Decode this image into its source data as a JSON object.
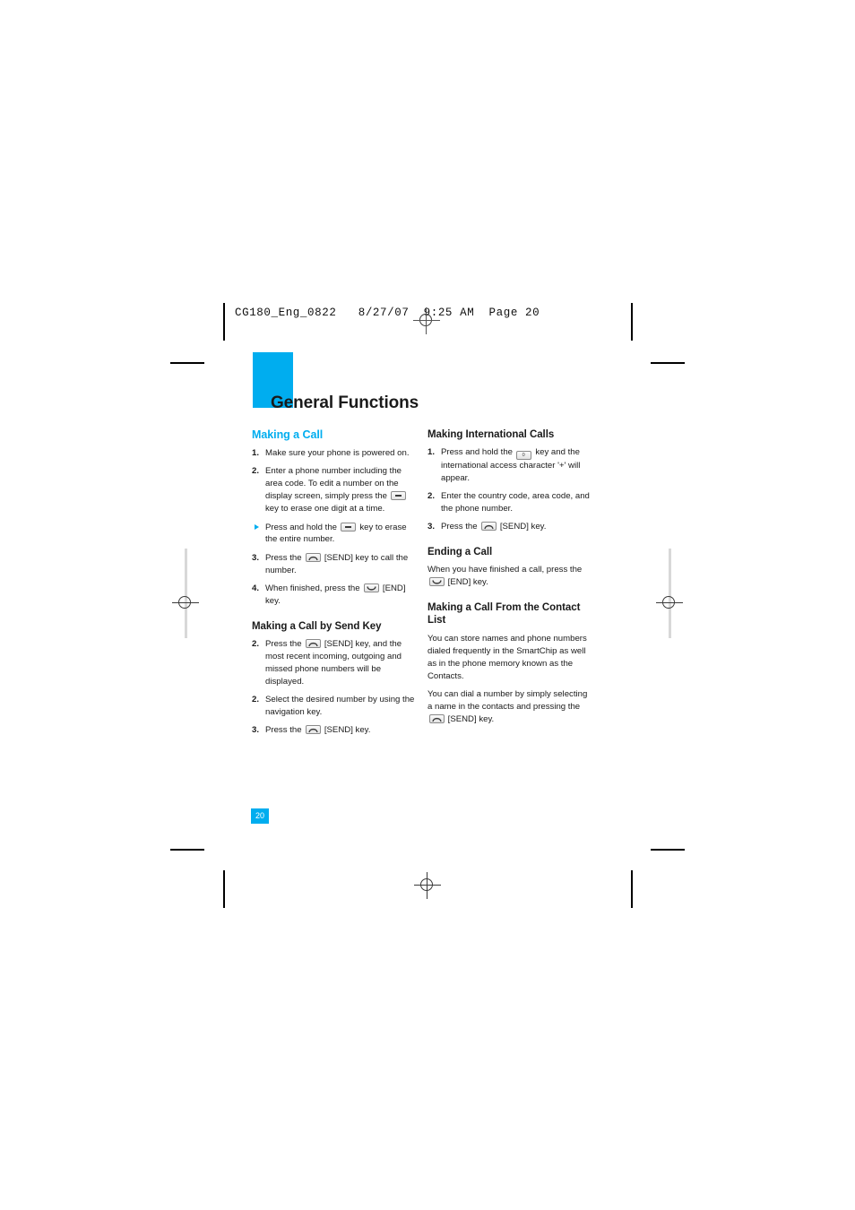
{
  "prepress": {
    "file_stamp": "CG180_Eng_0822   8/27/07  9:25 AM  Page 20"
  },
  "chapter": {
    "title": "General Functions"
  },
  "left_column": {
    "heading_making_a_call": "Making a Call",
    "steps_making_a_call": [
      {
        "num": "1.",
        "parts": [
          {
            "type": "text",
            "value": "Make sure your phone is powered on."
          }
        ]
      },
      {
        "num": "2.",
        "parts": [
          {
            "type": "text",
            "value": "Enter a phone number including the area code. To edit a number on the display screen, simply press the "
          },
          {
            "type": "key",
            "icon": "clear-key-icon"
          },
          {
            "type": "text",
            "value": " key to erase one digit at a time."
          }
        ]
      }
    ],
    "sub_bullet": {
      "parts": [
        {
          "type": "text",
          "value": "Press and hold the "
        },
        {
          "type": "key",
          "icon": "clear-key-icon"
        },
        {
          "type": "text",
          "value": " key to erase the entire number."
        }
      ]
    },
    "steps_making_a_call_cont": [
      {
        "num": "3.",
        "parts": [
          {
            "type": "text",
            "value": "Press the "
          },
          {
            "type": "key",
            "icon": "send-key-icon"
          },
          {
            "type": "text",
            "value": " [SEND] key to call the number."
          }
        ]
      },
      {
        "num": "4.",
        "parts": [
          {
            "type": "text",
            "value": "When finished, press the "
          },
          {
            "type": "key",
            "icon": "end-key-icon"
          },
          {
            "type": "text",
            "value": " [END] key."
          }
        ]
      }
    ],
    "heading_send_key": "Making a Call by Send Key",
    "steps_send_key": [
      {
        "num": "2.",
        "parts": [
          {
            "type": "text",
            "value": "Press the "
          },
          {
            "type": "key",
            "icon": "send-key-icon"
          },
          {
            "type": "text",
            "value": " [SEND] key, and the most recent incoming, outgoing and missed phone numbers will be displayed."
          }
        ]
      },
      {
        "num": "2.",
        "parts": [
          {
            "type": "text",
            "value": "Select the desired number by using the navigation key."
          }
        ]
      },
      {
        "num": "3.",
        "parts": [
          {
            "type": "text",
            "value": "Press the "
          },
          {
            "type": "key",
            "icon": "send-key-icon"
          },
          {
            "type": "text",
            "value": " [SEND] key."
          }
        ]
      }
    ]
  },
  "right_column": {
    "heading_international": "Making International Calls",
    "steps_international": [
      {
        "num": "1.",
        "parts": [
          {
            "type": "text",
            "value": "Press and hold the "
          },
          {
            "type": "key",
            "icon": "zero-key-icon",
            "label": "0"
          },
          {
            "type": "text",
            "value": " key and the international access character '+' will appear."
          }
        ]
      },
      {
        "num": "2.",
        "parts": [
          {
            "type": "text",
            "value": "Enter the country code, area code, and the phone number."
          }
        ]
      },
      {
        "num": "3.",
        "parts": [
          {
            "type": "text",
            "value": "Press the "
          },
          {
            "type": "key",
            "icon": "send-key-icon"
          },
          {
            "type": "text",
            "value": " [SEND] key."
          }
        ]
      }
    ],
    "heading_ending": "Ending a Call",
    "ending_paragraph": {
      "parts": [
        {
          "type": "text",
          "value": "When you have finished a call, press the "
        },
        {
          "type": "key",
          "icon": "end-key-icon"
        },
        {
          "type": "text",
          "value": " [END] key."
        }
      ]
    },
    "heading_contact_list": "Making a Call From the Contact List",
    "contact_paragraph_1": {
      "parts": [
        {
          "type": "text",
          "value": "You can store names and phone numbers dialed frequently in the SmartChip as well as in the phone memory known as the Contacts."
        }
      ]
    },
    "contact_paragraph_2": {
      "parts": [
        {
          "type": "text",
          "value": "You can dial a number by simply selecting a name in the contacts and pressing the "
        },
        {
          "type": "key",
          "icon": "send-key-icon"
        },
        {
          "type": "text",
          "value": " [SEND] key."
        }
      ]
    }
  },
  "footer": {
    "page_number": "20"
  },
  "colors": {
    "accent": "#00ADEF",
    "text": "#1a1a1a"
  }
}
